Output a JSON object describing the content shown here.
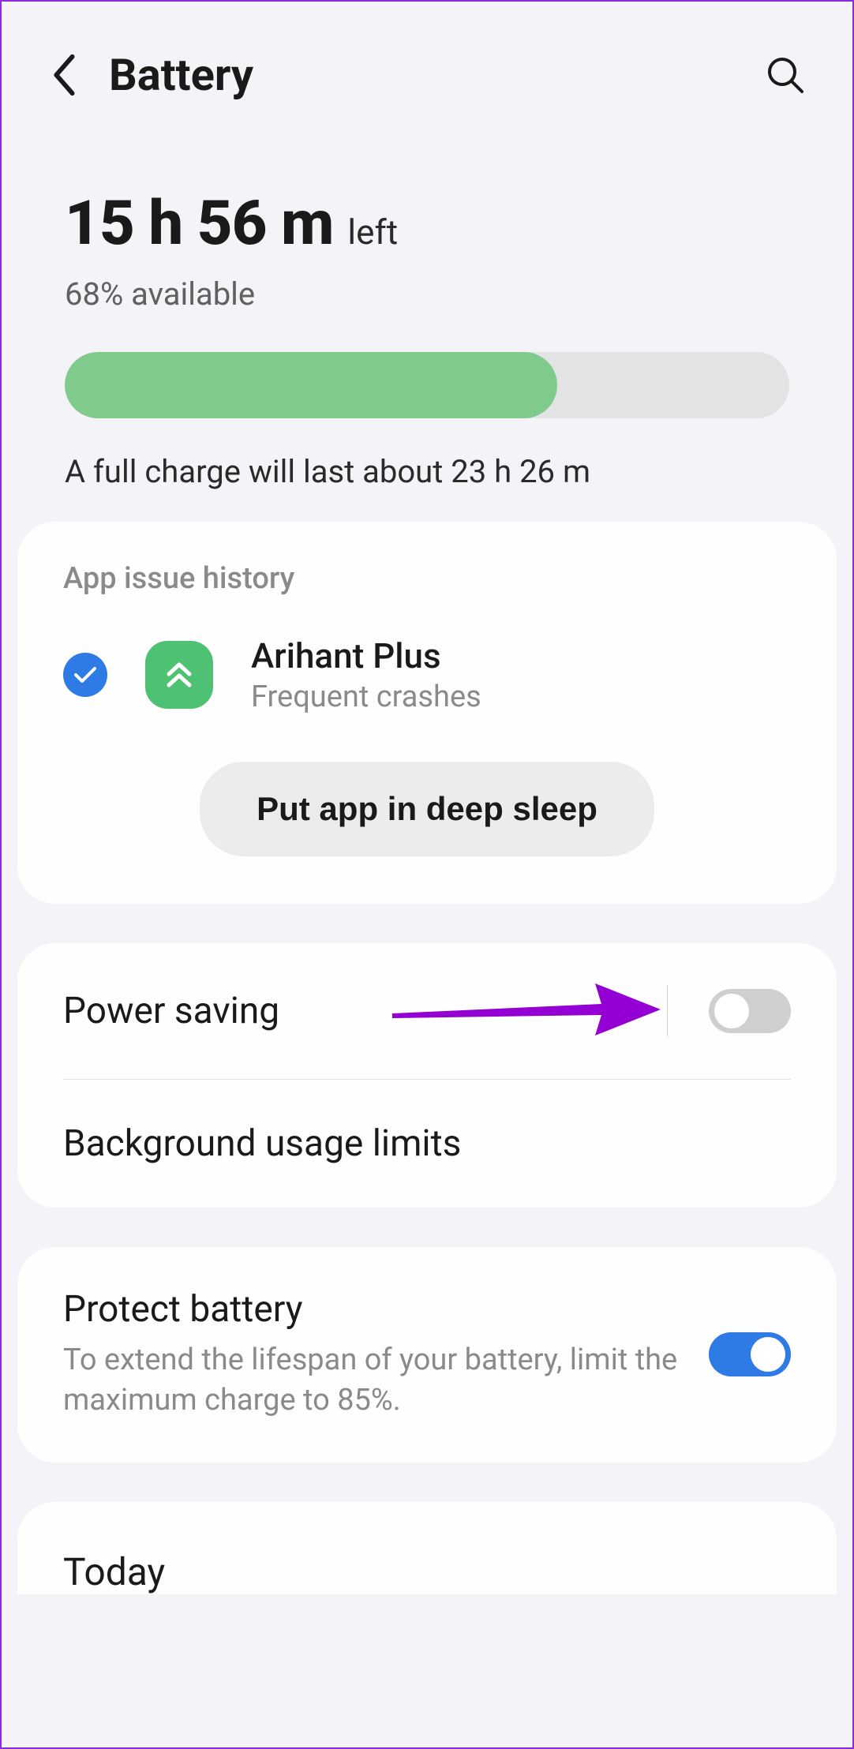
{
  "header": {
    "title": "Battery"
  },
  "summary": {
    "time_value": "15 h 56 m",
    "time_suffix": "left",
    "available": "68% available",
    "progress_percent": 68,
    "full_charge_note": "A full charge will last about 23 h 26 m"
  },
  "issue_history": {
    "header": "App issue history",
    "app_name": "Arihant Plus",
    "issue_detail": "Frequent crashes",
    "action_button": "Put app in deep sleep"
  },
  "settings": {
    "power_saving": {
      "label": "Power saving",
      "enabled": false
    },
    "bg_limits": {
      "label": "Background usage limits"
    },
    "protect": {
      "label": "Protect battery",
      "sub": "To extend the lifespan of your battery, limit the maximum charge to 85%.",
      "enabled": true
    }
  },
  "today": {
    "title": "Today"
  },
  "colors": {
    "accent_blue": "#2f7be5",
    "progress_green": "#80cb8b",
    "annotation_purple": "#9400d3"
  }
}
